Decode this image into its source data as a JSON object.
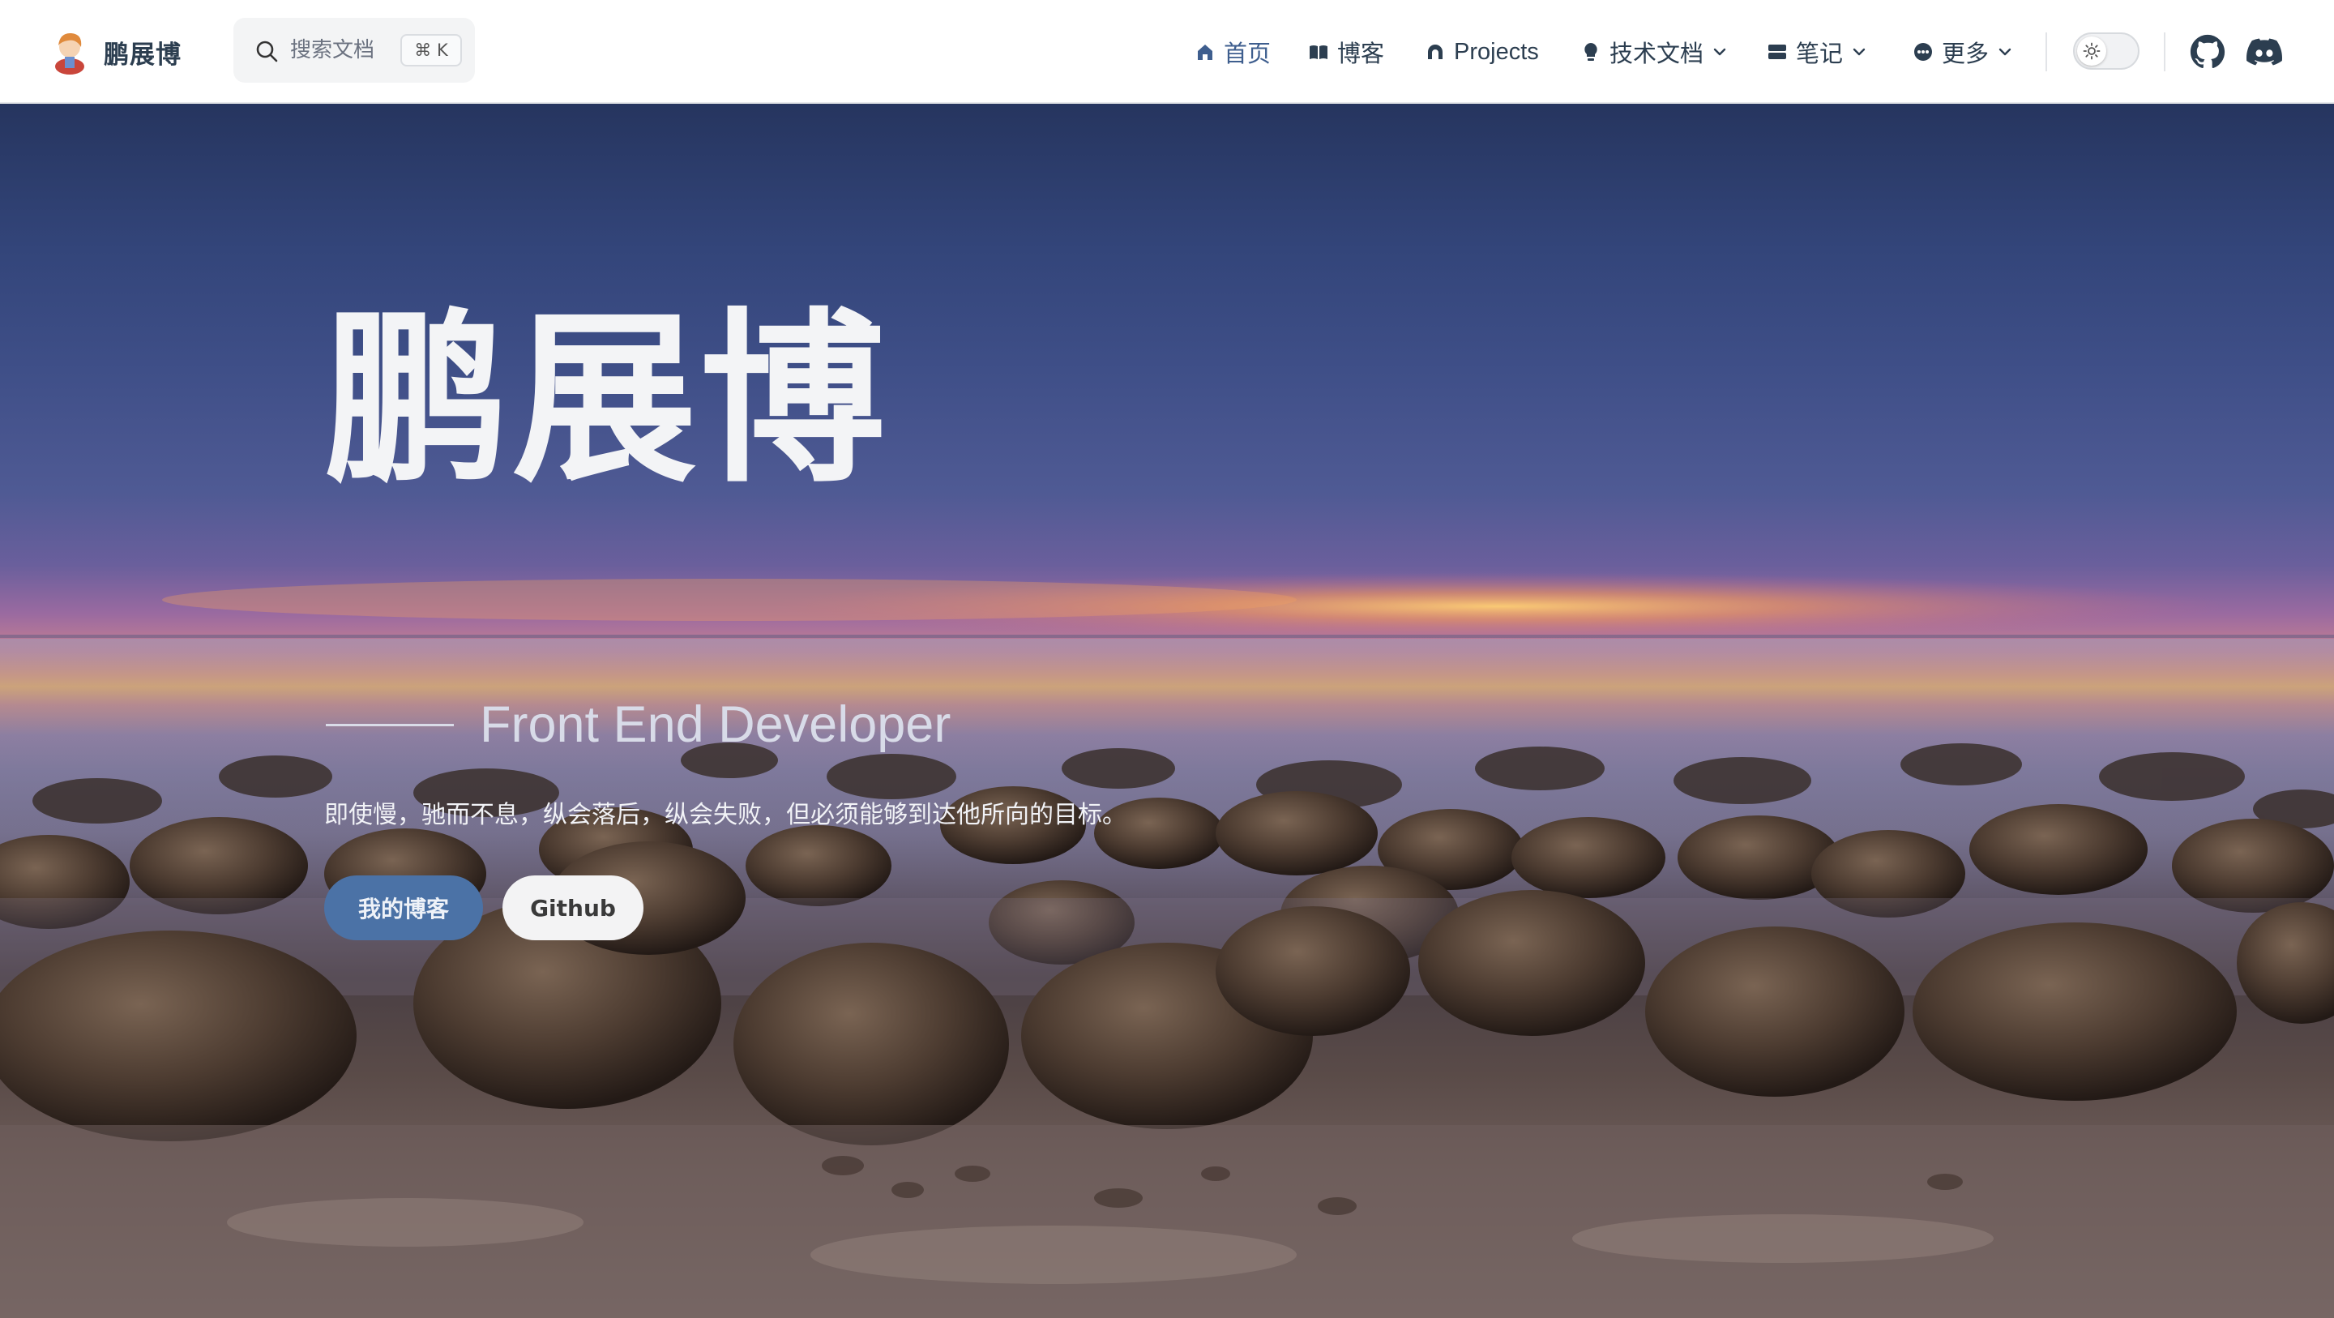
{
  "navbar": {
    "brand_name": "鹏展博",
    "search": {
      "placeholder": "搜索文档",
      "shortcut": "⌘ K"
    },
    "items": [
      {
        "label": "首页",
        "icon": "home-icon",
        "active": true
      },
      {
        "label": "博客",
        "icon": "book-icon"
      },
      {
        "label": "Projects",
        "icon": "projects-icon"
      },
      {
        "label": "技术文档",
        "icon": "lightbulb-icon",
        "dropdown": true
      },
      {
        "label": "笔记",
        "icon": "notes-icon",
        "dropdown": true
      },
      {
        "label": "更多",
        "icon": "more-icon",
        "dropdown": true
      }
    ],
    "theme_toggle": {
      "icon": "sun-icon",
      "mode": "light"
    },
    "social": [
      {
        "icon": "github-icon"
      },
      {
        "icon": "discord-icon"
      }
    ]
  },
  "hero": {
    "title": "鹏展博",
    "subtitle": "Front End Developer",
    "tagline": "即使慢，驰而不息，纵会落后，纵会失败，但必须能够到达他所向的目标。",
    "buttons": {
      "primary": "我的博客",
      "secondary": "Github"
    }
  },
  "colors": {
    "accent": "#3e5e8e",
    "primary_button": "#4b72a6",
    "text": "#2c3e50"
  }
}
